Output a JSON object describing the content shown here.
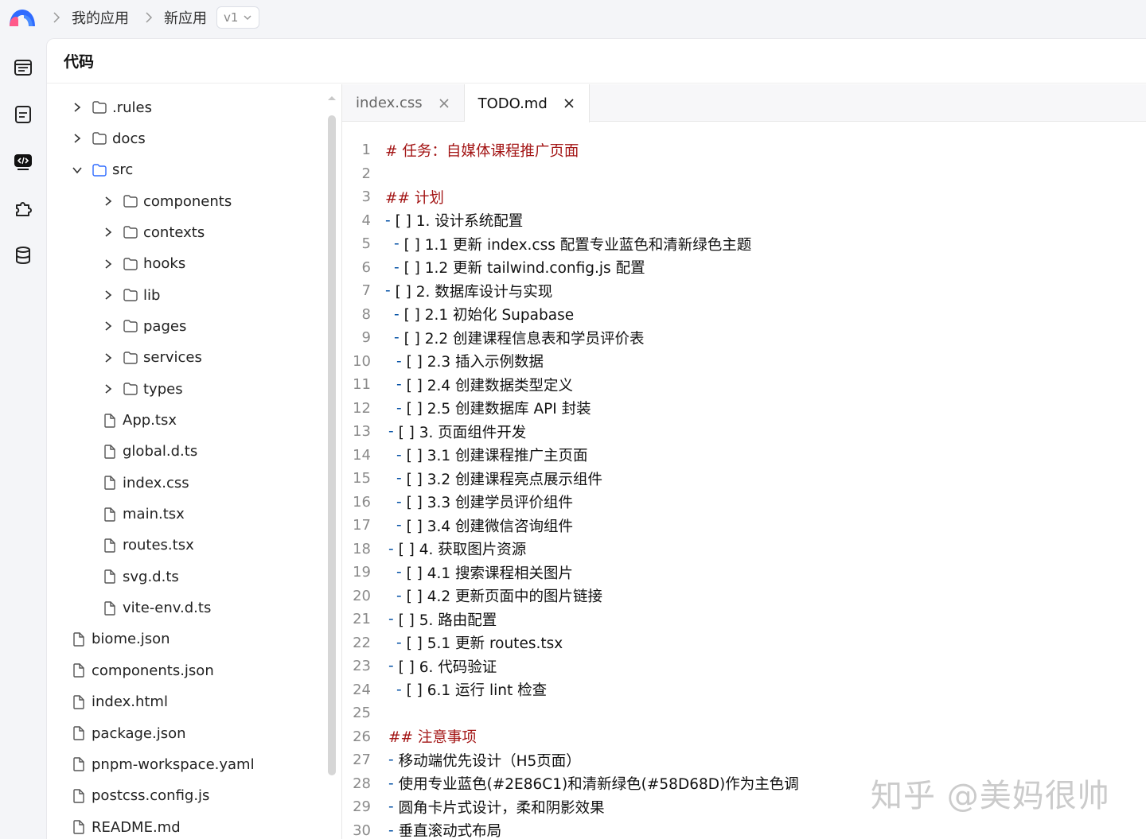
{
  "breadcrumb": {
    "items": [
      "我的应用",
      "新应用"
    ],
    "version": "v1"
  },
  "panel": {
    "title": "代码"
  },
  "tree": [
    {
      "label": ".rules",
      "type": "folder",
      "depth": 0,
      "state": "collapsed"
    },
    {
      "label": "docs",
      "type": "folder",
      "depth": 0,
      "state": "collapsed"
    },
    {
      "label": "src",
      "type": "folder",
      "depth": 0,
      "state": "expanded"
    },
    {
      "label": "components",
      "type": "folder",
      "depth": 1,
      "state": "collapsed"
    },
    {
      "label": "contexts",
      "type": "folder",
      "depth": 1,
      "state": "collapsed"
    },
    {
      "label": "hooks",
      "type": "folder",
      "depth": 1,
      "state": "collapsed"
    },
    {
      "label": "lib",
      "type": "folder",
      "depth": 1,
      "state": "collapsed"
    },
    {
      "label": "pages",
      "type": "folder",
      "depth": 1,
      "state": "collapsed"
    },
    {
      "label": "services",
      "type": "folder",
      "depth": 1,
      "state": "collapsed"
    },
    {
      "label": "types",
      "type": "folder",
      "depth": 1,
      "state": "collapsed"
    },
    {
      "label": "App.tsx",
      "type": "file",
      "depth": 1
    },
    {
      "label": "global.d.ts",
      "type": "file",
      "depth": 1
    },
    {
      "label": "index.css",
      "type": "file",
      "depth": 1
    },
    {
      "label": "main.tsx",
      "type": "file",
      "depth": 1
    },
    {
      "label": "routes.tsx",
      "type": "file",
      "depth": 1
    },
    {
      "label": "svg.d.ts",
      "type": "file",
      "depth": 1
    },
    {
      "label": "vite-env.d.ts",
      "type": "file",
      "depth": 1
    },
    {
      "label": "biome.json",
      "type": "file",
      "depth": 0
    },
    {
      "label": "components.json",
      "type": "file",
      "depth": 0
    },
    {
      "label": "index.html",
      "type": "file",
      "depth": 0
    },
    {
      "label": "package.json",
      "type": "file",
      "depth": 0
    },
    {
      "label": "pnpm-workspace.yaml",
      "type": "file",
      "depth": 0
    },
    {
      "label": "postcss.config.js",
      "type": "file",
      "depth": 0
    },
    {
      "label": "README.md",
      "type": "file",
      "depth": 0
    }
  ],
  "tabs": [
    {
      "label": "index.css",
      "active": false
    },
    {
      "label": "TODO.md",
      "active": true
    }
  ],
  "code_lines": [
    {
      "n": "1",
      "indent": "",
      "dash": "",
      "text": "# 任务：自媒体课程推广页面",
      "kind": "heading"
    },
    {
      "n": "2",
      "indent": "",
      "dash": "",
      "text": "",
      "kind": "text"
    },
    {
      "n": "3",
      "indent": "",
      "dash": "",
      "text": "## 计划",
      "kind": "heading"
    },
    {
      "n": "4",
      "indent": "",
      "dash": "- ",
      "text": "[ ] 1. 设计系统配置",
      "kind": "text"
    },
    {
      "n": "5",
      "indent": " ",
      "dash": "- ",
      "text": "[ ] 1.1 更新 index.css 配置专业蓝色和清新绿色主题",
      "kind": "text"
    },
    {
      "n": "6",
      "indent": " ",
      "dash": "- ",
      "text": "[ ] 1.2 更新 tailwind.config.js 配置",
      "kind": "text"
    },
    {
      "n": "7",
      "indent": "",
      "dash": "- ",
      "text": "[ ] 2. 数据库设计与实现",
      "kind": "text"
    },
    {
      "n": "8",
      "indent": " ",
      "dash": "- ",
      "text": "[ ] 2.1 初始化 Supabase",
      "kind": "text"
    },
    {
      "n": "9",
      "indent": " ",
      "dash": "- ",
      "text": "[ ] 2.2 创建课程信息表和学员评价表",
      "kind": "text"
    },
    {
      "n": "10",
      "indent": " ",
      "dash": "- ",
      "text": "[ ] 2.3 插入示例数据",
      "kind": "text"
    },
    {
      "n": "11",
      "indent": " ",
      "dash": "- ",
      "text": "[ ] 2.4 创建数据类型定义",
      "kind": "text"
    },
    {
      "n": "12",
      "indent": " ",
      "dash": "- ",
      "text": "[ ] 2.5 创建数据库 API 封装",
      "kind": "text"
    },
    {
      "n": "13",
      "indent": "",
      "dash": "- ",
      "text": "[ ] 3. 页面组件开发",
      "kind": "text"
    },
    {
      "n": "14",
      "indent": " ",
      "dash": "- ",
      "text": "[ ] 3.1 创建课程推广主页面",
      "kind": "text"
    },
    {
      "n": "15",
      "indent": " ",
      "dash": "- ",
      "text": "[ ] 3.2 创建课程亮点展示组件",
      "kind": "text"
    },
    {
      "n": "16",
      "indent": " ",
      "dash": "- ",
      "text": "[ ] 3.3 创建学员评价组件",
      "kind": "text"
    },
    {
      "n": "17",
      "indent": " ",
      "dash": "- ",
      "text": "[ ] 3.4 创建微信咨询组件",
      "kind": "text"
    },
    {
      "n": "18",
      "indent": "",
      "dash": "- ",
      "text": "[ ] 4. 获取图片资源",
      "kind": "text"
    },
    {
      "n": "19",
      "indent": " ",
      "dash": "- ",
      "text": "[ ] 4.1 搜索课程相关图片",
      "kind": "text"
    },
    {
      "n": "20",
      "indent": " ",
      "dash": "- ",
      "text": "[ ] 4.2 更新页面中的图片链接",
      "kind": "text"
    },
    {
      "n": "21",
      "indent": "",
      "dash": "- ",
      "text": "[ ] 5. 路由配置",
      "kind": "text"
    },
    {
      "n": "22",
      "indent": " ",
      "dash": "- ",
      "text": "[ ] 5.1 更新 routes.tsx",
      "kind": "text"
    },
    {
      "n": "23",
      "indent": "",
      "dash": "- ",
      "text": "[ ] 6. 代码验证",
      "kind": "text"
    },
    {
      "n": "24",
      "indent": " ",
      "dash": "- ",
      "text": "[ ] 6.1 运行 lint 检查",
      "kind": "text"
    },
    {
      "n": "25",
      "indent": "",
      "dash": "",
      "text": "",
      "kind": "text"
    },
    {
      "n": "26",
      "indent": "",
      "dash": "",
      "text": "## 注意事项",
      "kind": "heading"
    },
    {
      "n": "27",
      "indent": "",
      "dash": "- ",
      "text": "移动端优先设计（H5页面）",
      "kind": "text"
    },
    {
      "n": "28",
      "indent": "",
      "dash": "- ",
      "text": "使用专业蓝色(#2E86C1)和清新绿色(#58D68D)作为主色调",
      "kind": "text"
    },
    {
      "n": "29",
      "indent": "",
      "dash": "- ",
      "text": "圆角卡片式设计，柔和阴影效果",
      "kind": "text"
    },
    {
      "n": "30",
      "indent": "",
      "dash": "- ",
      "text": "垂直滚动式布局",
      "kind": "text"
    }
  ],
  "watermark": "知乎 @美妈很帅",
  "colors": {
    "heading": "#a31515",
    "list_dash": "#0451a5",
    "line_number": "#8a8a8a",
    "logo_blue": "#2f6bff",
    "logo_pink": "#ff5a8a"
  }
}
